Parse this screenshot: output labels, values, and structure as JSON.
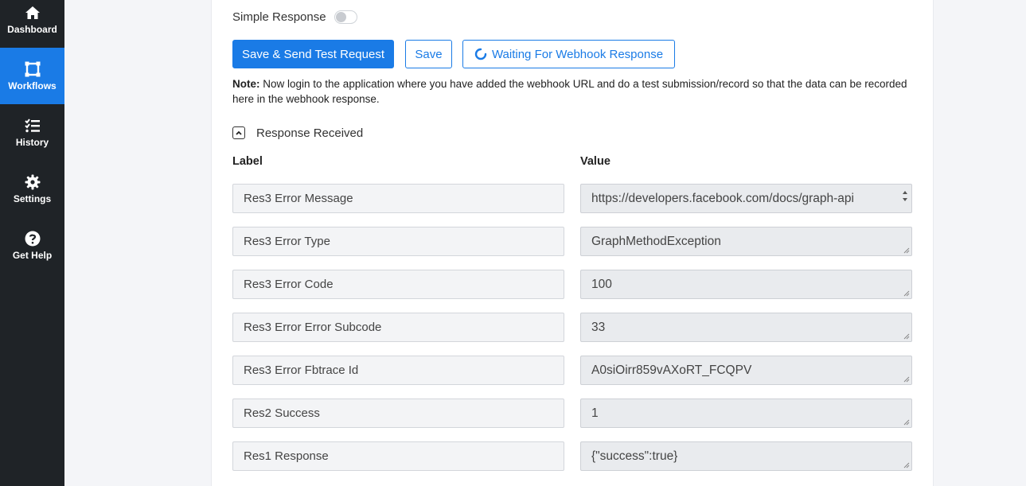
{
  "sidebar": {
    "items": [
      {
        "label": "Dashboard",
        "icon": "home-icon"
      },
      {
        "label": "Workflows",
        "icon": "workflow-icon",
        "active": true
      },
      {
        "label": "History",
        "icon": "list-check-icon"
      },
      {
        "label": "Settings",
        "icon": "gear-icon"
      },
      {
        "label": "Get Help",
        "icon": "question-circle-icon"
      }
    ],
    "active_color": "#1a7be6",
    "background": "#1f2327"
  },
  "simple_response": {
    "label": "Simple Response",
    "enabled": false
  },
  "buttons": {
    "save_send": "Save & Send Test Request",
    "save": "Save",
    "waiting": "Waiting For Webhook Response"
  },
  "note": {
    "prefix": "Note:",
    "text": " Now login to the application where you have added the webhook URL and do a test submission/record so that the data can be recorded here in the webhook response."
  },
  "response": {
    "title": "Response Received",
    "label_header": "Label",
    "value_header": "Value",
    "rows": [
      {
        "label": "Res3 Error Message",
        "value": "https://developers.facebook.com/docs/graph-api"
      },
      {
        "label": "Res3 Error Type",
        "value": "GraphMethodException"
      },
      {
        "label": "Res3 Error Code",
        "value": "100"
      },
      {
        "label": "Res3 Error Error Subcode",
        "value": "33"
      },
      {
        "label": "Res3 Error Fbtrace Id",
        "value": "A0siOirr859vAXoRT_FCQPV"
      },
      {
        "label": "Res2 Success",
        "value": "1"
      },
      {
        "label": "Res1 Response",
        "value": "{\"success\":true}"
      }
    ]
  }
}
